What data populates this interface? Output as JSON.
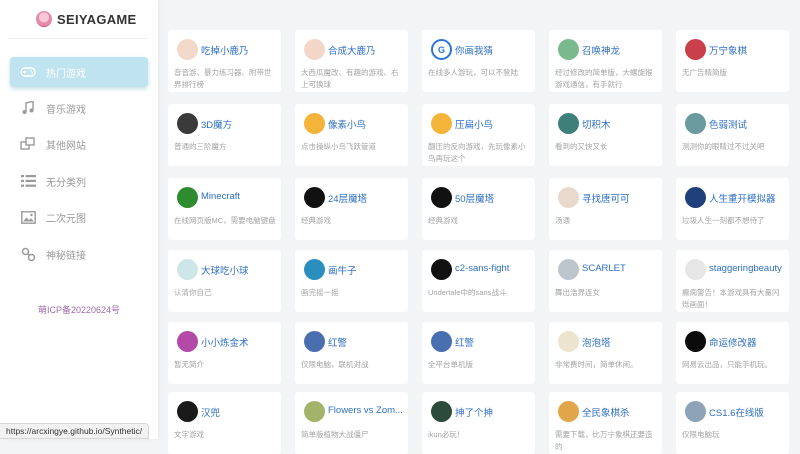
{
  "brand": {
    "name": "SEIYAGAME"
  },
  "sidebar": {
    "items": [
      {
        "label": "热门游戏",
        "icon": "gamepad-icon",
        "active": true
      },
      {
        "label": "音乐游戏",
        "icon": "music-note-icon",
        "active": false
      },
      {
        "label": "其他网站",
        "icon": "windows-icon",
        "active": false
      },
      {
        "label": "无分类列",
        "icon": "list-icon",
        "active": false
      },
      {
        "label": "二次元图",
        "icon": "image-icon",
        "active": false
      },
      {
        "label": "神秘链接",
        "icon": "link-icon",
        "active": false
      }
    ],
    "icp": "萌ICP备20220624号"
  },
  "status_url": "https://arcxingye.github.io/Synthetic/",
  "cards": [
    {
      "title": "吃掉小鹿乃",
      "desc": "音音游、暴力练习器、附带世界排行榜",
      "thumb": "anime-girl-icon",
      "color": "#f2d9c9"
    },
    {
      "title": "合成大鹿乃",
      "desc": "大西瓜魔改、有趣的游戏、右上可换球",
      "thumb": "anime-girl-icon",
      "color": "#f3d6c8"
    },
    {
      "title": "你画我猜",
      "desc": "在线多人游玩，可以不登陆",
      "thumb": "google-g-icon",
      "color": "#ffffff"
    },
    {
      "title": "召唤神龙",
      "desc": "经过修改的简单版，大螺旋猴游戏通信，有手就行",
      "thumb": "dragon-icon",
      "color": "#7ab88e"
    },
    {
      "title": "万宁象棋",
      "desc": "无广告精简版",
      "thumb": "anime-girl-icon",
      "color": "#c9404a"
    },
    {
      "title": "3D魔方",
      "desc": "普通的三阶魔方",
      "thumb": "rubiks-cube-icon",
      "color": "#3a3a3a"
    },
    {
      "title": "像素小鸟",
      "desc": "点击操纵小鸟飞跃管道",
      "thumb": "flappy-bird-icon",
      "color": "#f4b43a"
    },
    {
      "title": "压扁小鸟",
      "desc": "翻压的反向游戏，先玩像素小鸟再玩这个",
      "thumb": "flappy-bird-icon",
      "color": "#f4b43a"
    },
    {
      "title": "切积木",
      "desc": "看到的又快又长",
      "thumb": "block-icon",
      "color": "#3f7f7a"
    },
    {
      "title": "色弱测试",
      "desc": "测测你的眼睛过不过关吧",
      "thumb": "grid-icon",
      "color": "#6a9a9e"
    },
    {
      "title": "Minecraft",
      "desc": "在线网页版MC，需要电脑键盘",
      "thumb": "creeper-icon",
      "color": "#2e8b2e"
    },
    {
      "title": "24层魔塔",
      "desc": "经典游戏",
      "thumb": "mota-icon",
      "color": "#111111"
    },
    {
      "title": "50层魔塔",
      "desc": "经典游戏",
      "thumb": "mota-icon",
      "color": "#111111"
    },
    {
      "title": "寻找唐可可",
      "desc": "汤通",
      "thumb": "anime-girl-icon",
      "color": "#e9d9cc"
    },
    {
      "title": "人生重开模拟器",
      "desc": "垃圾人生一刻都不想待了",
      "thumb": "lr-logo-icon",
      "color": "#1f3f7a"
    },
    {
      "title": "大球吃小球",
      "desc": "认清你自己",
      "thumb": "ball-icon",
      "color": "#cfe6e8"
    },
    {
      "title": "画牛子",
      "desc": "画完摇一摇",
      "thumb": "swirl-icon",
      "color": "#2a8fbf"
    },
    {
      "title": "c2-sans-fight",
      "desc": "Undertale中的sans战斗",
      "thumb": "skull-icon",
      "color": "#111111"
    },
    {
      "title": "SCARLET",
      "desc": "舞出浩界连女",
      "thumb": "scarlet-icon",
      "color": "#bcc4cc"
    },
    {
      "title": "staggeringbeauty",
      "desc": "癫痫警告！本游戏具有大量闪烁画面！",
      "thumb": "worm-icon",
      "color": "#e6e6e6"
    },
    {
      "title": "小小炼金术",
      "desc": "暂无简介",
      "thumb": "flask-icon",
      "color": "#b44aa8"
    },
    {
      "title": "红警",
      "desc": "仅限电脑，联机对战",
      "thumb": "red-alert-icon",
      "color": "#4a6fb0"
    },
    {
      "title": "红警",
      "desc": "全平台单机版",
      "thumb": "red-alert-icon",
      "color": "#4a6fb0"
    },
    {
      "title": "泡泡塔",
      "desc": "非常费时间，简单休闲。",
      "thumb": "bubble-tower-icon",
      "color": "#ece4cf"
    },
    {
      "title": "命运修改器",
      "desc": "网易云出品，只能手机玩。",
      "thumb": "smiley-icon",
      "color": "#0a0a0a"
    },
    {
      "title": "汉兜",
      "desc": "文字游戏",
      "thumb": "handou-icon",
      "color": "#1a1a1a"
    },
    {
      "title": "Flowers vs Zom...",
      "desc": "简单版植物大战僵尸",
      "thumb": "zombie-icon",
      "color": "#a3b46a"
    },
    {
      "title": "抻了个抻",
      "desc": "ikun必玩！",
      "thumb": "sheep-icon",
      "color": "#2c4b3a"
    },
    {
      "title": "全民象棋杀",
      "desc": "需要下载，比万宁象棋还要造的",
      "thumb": "chess-kill-icon",
      "color": "#e2a64a"
    },
    {
      "title": "CS1.6在线版",
      "desc": "仅限电脑玩",
      "thumb": "cs-icon",
      "color": "#8ea2b8"
    }
  ]
}
